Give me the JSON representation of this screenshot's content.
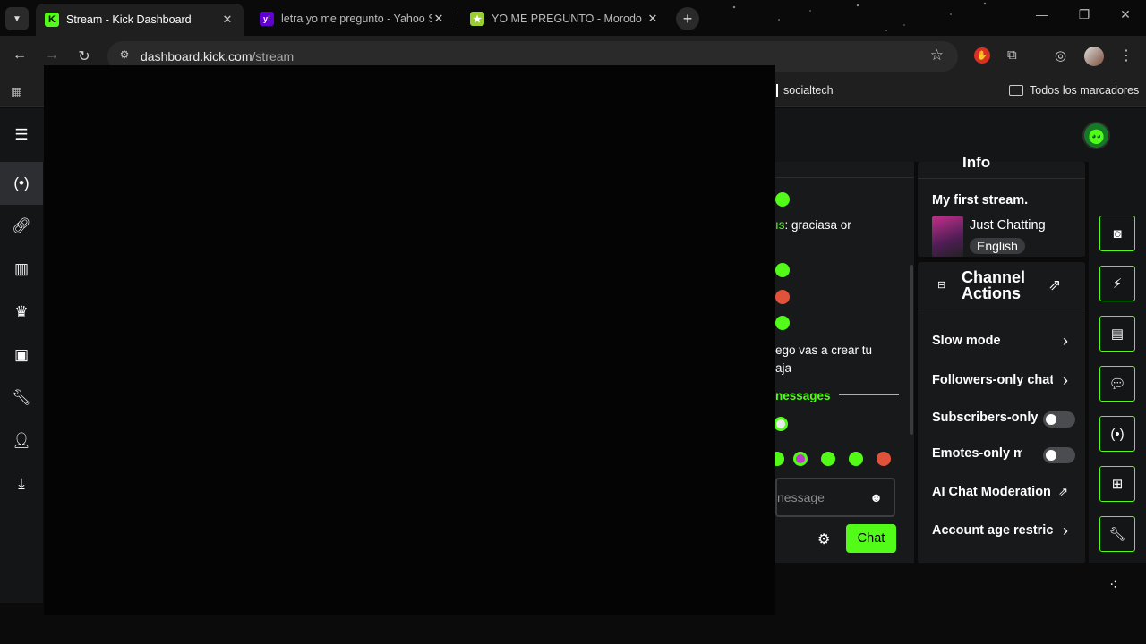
{
  "browser": {
    "tabs": [
      {
        "title": "Stream - Kick Dashboard",
        "favicon": "K"
      },
      {
        "title": "letra yo me pregunto - Yahoo S",
        "favicon": "y!"
      },
      {
        "title": "YO ME PREGUNTO - Morodo - ",
        "favicon": "★"
      }
    ],
    "url_domain": "dashboard.kick.com",
    "url_path": "/stream",
    "bookmarks": {
      "item": "socialtech",
      "all": "Todos los marcadores"
    }
  },
  "chat": {
    "msg1_user": "ıs",
    "msg1_text": ": graciasa or",
    "msg2_line1": "ego vas a crear tu",
    "msg2_line2": "aja",
    "new_messages": "nessages",
    "input_placeholder": "nessage",
    "send_label": "Chat"
  },
  "info": {
    "title": "Info",
    "stream_title": "My first stream.",
    "category": "Just Chatting",
    "language": "English"
  },
  "actions": {
    "title": "Channel Actions",
    "rows": [
      {
        "label": "Slow mode"
      },
      {
        "label": "Followers-only chat"
      },
      {
        "label": "Subscribers-only"
      },
      {
        "label": "Emotes-only mode"
      },
      {
        "label": "AI Chat Moderation"
      },
      {
        "label": "Account age restriction"
      }
    ]
  },
  "colors": {
    "accent": "#53fc18"
  }
}
